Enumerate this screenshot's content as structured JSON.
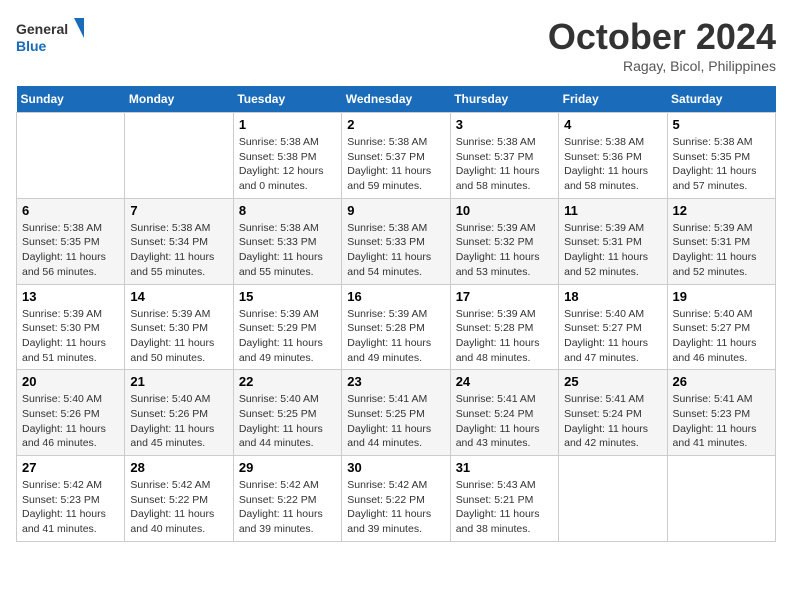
{
  "header": {
    "logo_general": "General",
    "logo_blue": "Blue",
    "month": "October 2024",
    "location": "Ragay, Bicol, Philippines"
  },
  "days_of_week": [
    "Sunday",
    "Monday",
    "Tuesday",
    "Wednesday",
    "Thursday",
    "Friday",
    "Saturday"
  ],
  "weeks": [
    [
      {
        "day": "",
        "content": ""
      },
      {
        "day": "",
        "content": ""
      },
      {
        "day": "1",
        "content": "Sunrise: 5:38 AM\nSunset: 5:38 PM\nDaylight: 12 hours\nand 0 minutes."
      },
      {
        "day": "2",
        "content": "Sunrise: 5:38 AM\nSunset: 5:37 PM\nDaylight: 11 hours\nand 59 minutes."
      },
      {
        "day": "3",
        "content": "Sunrise: 5:38 AM\nSunset: 5:37 PM\nDaylight: 11 hours\nand 58 minutes."
      },
      {
        "day": "4",
        "content": "Sunrise: 5:38 AM\nSunset: 5:36 PM\nDaylight: 11 hours\nand 58 minutes."
      },
      {
        "day": "5",
        "content": "Sunrise: 5:38 AM\nSunset: 5:35 PM\nDaylight: 11 hours\nand 57 minutes."
      }
    ],
    [
      {
        "day": "6",
        "content": "Sunrise: 5:38 AM\nSunset: 5:35 PM\nDaylight: 11 hours\nand 56 minutes."
      },
      {
        "day": "7",
        "content": "Sunrise: 5:38 AM\nSunset: 5:34 PM\nDaylight: 11 hours\nand 55 minutes."
      },
      {
        "day": "8",
        "content": "Sunrise: 5:38 AM\nSunset: 5:33 PM\nDaylight: 11 hours\nand 55 minutes."
      },
      {
        "day": "9",
        "content": "Sunrise: 5:38 AM\nSunset: 5:33 PM\nDaylight: 11 hours\nand 54 minutes."
      },
      {
        "day": "10",
        "content": "Sunrise: 5:39 AM\nSunset: 5:32 PM\nDaylight: 11 hours\nand 53 minutes."
      },
      {
        "day": "11",
        "content": "Sunrise: 5:39 AM\nSunset: 5:31 PM\nDaylight: 11 hours\nand 52 minutes."
      },
      {
        "day": "12",
        "content": "Sunrise: 5:39 AM\nSunset: 5:31 PM\nDaylight: 11 hours\nand 52 minutes."
      }
    ],
    [
      {
        "day": "13",
        "content": "Sunrise: 5:39 AM\nSunset: 5:30 PM\nDaylight: 11 hours\nand 51 minutes."
      },
      {
        "day": "14",
        "content": "Sunrise: 5:39 AM\nSunset: 5:30 PM\nDaylight: 11 hours\nand 50 minutes."
      },
      {
        "day": "15",
        "content": "Sunrise: 5:39 AM\nSunset: 5:29 PM\nDaylight: 11 hours\nand 49 minutes."
      },
      {
        "day": "16",
        "content": "Sunrise: 5:39 AM\nSunset: 5:28 PM\nDaylight: 11 hours\nand 49 minutes."
      },
      {
        "day": "17",
        "content": "Sunrise: 5:39 AM\nSunset: 5:28 PM\nDaylight: 11 hours\nand 48 minutes."
      },
      {
        "day": "18",
        "content": "Sunrise: 5:40 AM\nSunset: 5:27 PM\nDaylight: 11 hours\nand 47 minutes."
      },
      {
        "day": "19",
        "content": "Sunrise: 5:40 AM\nSunset: 5:27 PM\nDaylight: 11 hours\nand 46 minutes."
      }
    ],
    [
      {
        "day": "20",
        "content": "Sunrise: 5:40 AM\nSunset: 5:26 PM\nDaylight: 11 hours\nand 46 minutes."
      },
      {
        "day": "21",
        "content": "Sunrise: 5:40 AM\nSunset: 5:26 PM\nDaylight: 11 hours\nand 45 minutes."
      },
      {
        "day": "22",
        "content": "Sunrise: 5:40 AM\nSunset: 5:25 PM\nDaylight: 11 hours\nand 44 minutes."
      },
      {
        "day": "23",
        "content": "Sunrise: 5:41 AM\nSunset: 5:25 PM\nDaylight: 11 hours\nand 44 minutes."
      },
      {
        "day": "24",
        "content": "Sunrise: 5:41 AM\nSunset: 5:24 PM\nDaylight: 11 hours\nand 43 minutes."
      },
      {
        "day": "25",
        "content": "Sunrise: 5:41 AM\nSunset: 5:24 PM\nDaylight: 11 hours\nand 42 minutes."
      },
      {
        "day": "26",
        "content": "Sunrise: 5:41 AM\nSunset: 5:23 PM\nDaylight: 11 hours\nand 41 minutes."
      }
    ],
    [
      {
        "day": "27",
        "content": "Sunrise: 5:42 AM\nSunset: 5:23 PM\nDaylight: 11 hours\nand 41 minutes."
      },
      {
        "day": "28",
        "content": "Sunrise: 5:42 AM\nSunset: 5:22 PM\nDaylight: 11 hours\nand 40 minutes."
      },
      {
        "day": "29",
        "content": "Sunrise: 5:42 AM\nSunset: 5:22 PM\nDaylight: 11 hours\nand 39 minutes."
      },
      {
        "day": "30",
        "content": "Sunrise: 5:42 AM\nSunset: 5:22 PM\nDaylight: 11 hours\nand 39 minutes."
      },
      {
        "day": "31",
        "content": "Sunrise: 5:43 AM\nSunset: 5:21 PM\nDaylight: 11 hours\nand 38 minutes."
      },
      {
        "day": "",
        "content": ""
      },
      {
        "day": "",
        "content": ""
      }
    ]
  ]
}
